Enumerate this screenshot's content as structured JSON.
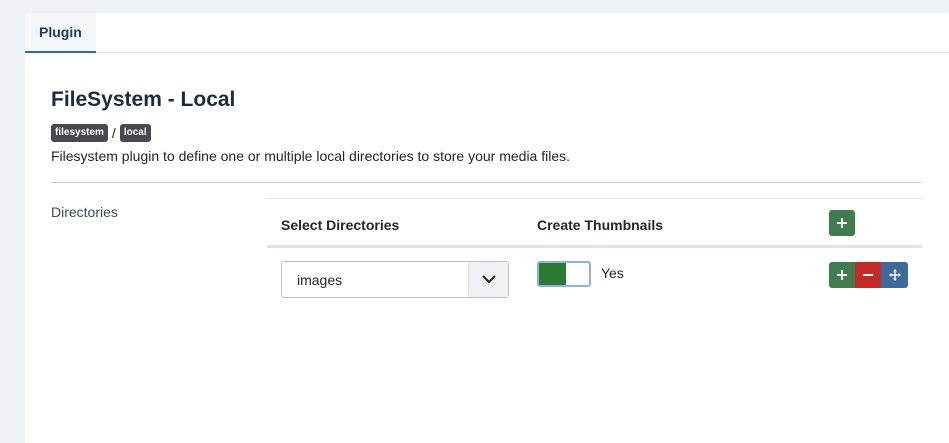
{
  "tabs": [
    {
      "label": "Plugin",
      "active": true
    }
  ],
  "plugin": {
    "title": "FileSystem - Local",
    "badges": [
      "filesystem",
      "local"
    ],
    "badge_separator": "/",
    "description": "Filesystem plugin to define one or multiple local directories to store your media files."
  },
  "field": {
    "label": "Directories",
    "columns": [
      "Select Directories",
      "Create Thumbnails"
    ],
    "header_add_icon": "plus-icon",
    "rows": [
      {
        "directory": "images",
        "thumbnails_enabled": true,
        "thumbnails_label": "Yes",
        "actions": [
          "plus-icon",
          "minus-icon",
          "move-icon"
        ]
      }
    ]
  },
  "colors": {
    "add": "#3f7d4d",
    "remove": "#c52827",
    "move": "#3d6a9a",
    "switch_on": "#2e7a32",
    "tab_active_border": "#2a69b8"
  }
}
